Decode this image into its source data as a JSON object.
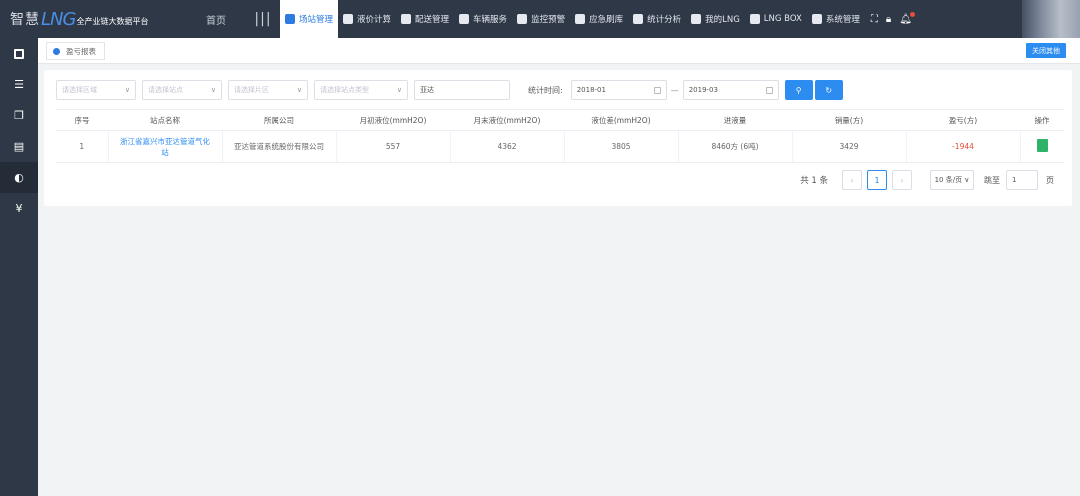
{
  "brand": {
    "cn": "智慧",
    "en": "LNG",
    "subtitle": "全产业链大数据平台"
  },
  "header": {
    "home_label": "首页",
    "nav": [
      {
        "label": "场站管理",
        "active": true
      },
      {
        "label": "液价计算",
        "active": false
      },
      {
        "label": "配送管理",
        "active": false
      },
      {
        "label": "车辆服务",
        "active": false
      },
      {
        "label": "监控预警",
        "active": false
      },
      {
        "label": "应急刷库",
        "active": false
      },
      {
        "label": "统计分析",
        "active": false
      },
      {
        "label": "我的LNG",
        "active": false
      },
      {
        "label": "LNG BOX",
        "active": false
      },
      {
        "label": "系统管理",
        "active": false
      }
    ]
  },
  "tabs": {
    "current": "盈亏报表",
    "close_others": "关闭其他"
  },
  "filters": {
    "select1": "请选择区域",
    "select2": "请选择站点",
    "select3": "请选择片区",
    "select4": "请选择站点类型",
    "keyword": "亚达",
    "stat_label": "统计时间:",
    "date_from": "2018-01",
    "date_to": "2019-03",
    "date_sep": "—"
  },
  "table": {
    "headers": [
      "序号",
      "站点名称",
      "所属公司",
      "月初液位(mmH2O)",
      "月末液位(mmH2O)",
      "液位差(mmH2O)",
      "进液量",
      "销量(方)",
      "盈亏(方)",
      "操作"
    ],
    "rows": [
      {
        "index": "1",
        "station": "浙江省嘉兴市亚达管道气化站",
        "company": "亚达管道系统股份有限公司",
        "start_level": "557",
        "end_level": "4362",
        "level_diff": "3805",
        "intake": "8460方 (6吨)",
        "sales": "3429",
        "profit": "-1944"
      }
    ]
  },
  "pagination": {
    "total": "共 1 条",
    "prev": "‹",
    "current_page": "1",
    "next": "›",
    "page_size": "10 条/页 ∨",
    "jump_label": "跳至",
    "jump_value": "1",
    "page_suffix": "页"
  }
}
